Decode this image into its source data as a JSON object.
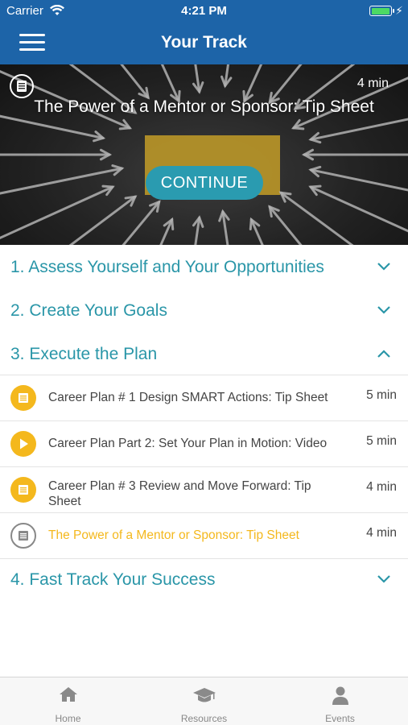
{
  "status_bar": {
    "carrier": "Carrier",
    "time": "4:21 PM",
    "battery_level": 1.0
  },
  "nav": {
    "title": "Your Track",
    "menu_icon": "hamburger-menu-icon"
  },
  "hero": {
    "title": "The Power of a Mentor or Sponsor: Tip Sheet",
    "duration": "4 min",
    "continue_label": "CONTINUE",
    "type_icon": "document-icon"
  },
  "sections": [
    {
      "label": "1. Assess Yourself and Your Opportunities",
      "expanded": false
    },
    {
      "label": "2. Create Your Goals",
      "expanded": false
    },
    {
      "label": "3. Execute the Plan",
      "expanded": true,
      "lessons": [
        {
          "title": "Career Plan # 1 Design SMART Actions: Tip Sheet",
          "duration": "5 min",
          "type": "document",
          "state": "done"
        },
        {
          "title": "Career Plan Part 2: Set Your Plan in Motion: Video",
          "duration": "5 min",
          "type": "video",
          "state": "done"
        },
        {
          "title": "Career Plan # 3 Review and Move Forward: Tip Sheet",
          "duration": "4 min",
          "type": "document",
          "state": "done"
        },
        {
          "title": "The Power of a Mentor or Sponsor: Tip Sheet",
          "duration": "4 min",
          "type": "document",
          "state": "current"
        }
      ]
    },
    {
      "label": "4. Fast Track Your Success",
      "expanded": false
    }
  ],
  "tabbar": {
    "tabs": [
      {
        "label": "Home",
        "icon": "home-icon"
      },
      {
        "label": "Resources",
        "icon": "graduation-cap-icon"
      },
      {
        "label": "Events",
        "icon": "person-icon"
      }
    ]
  },
  "colors": {
    "header_blue": "#1d64a8",
    "teal": "#2a96a8",
    "button_teal": "#2a9bb0",
    "completed_yellow": "#f4b81d",
    "battery_green": "#4cd964"
  }
}
